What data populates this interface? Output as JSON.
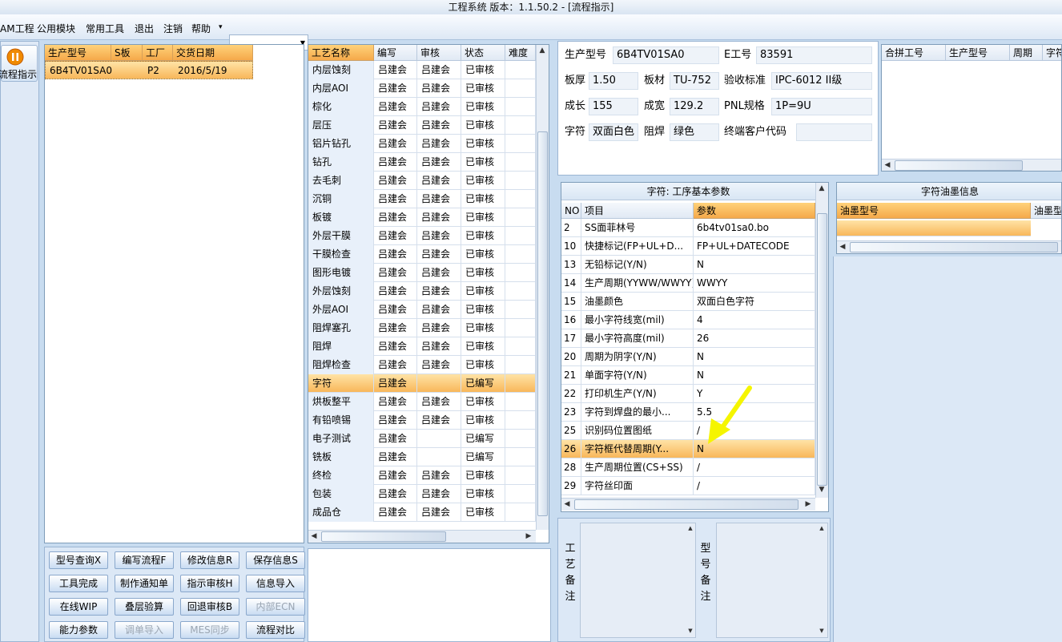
{
  "window": {
    "title": "工程系统  版本：1.1.50.2 - [流程指示]"
  },
  "menu": {
    "items": [
      "AM工程",
      "公用模块",
      "常用工具",
      "退出",
      "注销",
      "帮助"
    ],
    "help_arrow": "▾",
    "combo_value": ""
  },
  "sidebar": {
    "button_label": "流程指示",
    "icon": "pause-circle-icon"
  },
  "part_grid": {
    "headers": [
      "生产型号",
      "S板",
      "工厂",
      "交货日期"
    ],
    "rows": [
      [
        "6B4TV01SA0",
        "",
        "P2",
        "2016/5/19"
      ]
    ]
  },
  "process_grid": {
    "headers": [
      "工艺名称",
      "编写",
      "审核",
      "状态",
      "难度"
    ],
    "rows": [
      [
        "内层蚀刻",
        "吕建会",
        "吕建会",
        "已审核",
        ""
      ],
      [
        "内层AOI",
        "吕建会",
        "吕建会",
        "已审核",
        ""
      ],
      [
        "棕化",
        "吕建会",
        "吕建会",
        "已审核",
        ""
      ],
      [
        "层压",
        "吕建会",
        "吕建会",
        "已审核",
        ""
      ],
      [
        "铝片钻孔",
        "吕建会",
        "吕建会",
        "已审核",
        ""
      ],
      [
        "钻孔",
        "吕建会",
        "吕建会",
        "已审核",
        ""
      ],
      [
        "去毛刺",
        "吕建会",
        "吕建会",
        "已审核",
        ""
      ],
      [
        "沉铜",
        "吕建会",
        "吕建会",
        "已审核",
        ""
      ],
      [
        "板镀",
        "吕建会",
        "吕建会",
        "已审核",
        ""
      ],
      [
        "外层干膜",
        "吕建会",
        "吕建会",
        "已审核",
        ""
      ],
      [
        "干膜检查",
        "吕建会",
        "吕建会",
        "已审核",
        ""
      ],
      [
        "图形电镀",
        "吕建会",
        "吕建会",
        "已审核",
        ""
      ],
      [
        "外层蚀刻",
        "吕建会",
        "吕建会",
        "已审核",
        ""
      ],
      [
        "外层AOI",
        "吕建会",
        "吕建会",
        "已审核",
        ""
      ],
      [
        "阻焊塞孔",
        "吕建会",
        "吕建会",
        "已审核",
        ""
      ],
      [
        "阻焊",
        "吕建会",
        "吕建会",
        "已审核",
        ""
      ],
      [
        "阻焊检查",
        "吕建会",
        "吕建会",
        "已审核",
        ""
      ],
      [
        "字符",
        "吕建会",
        "",
        "已编写",
        ""
      ],
      [
        "烘板整平",
        "吕建会",
        "吕建会",
        "已审核",
        ""
      ],
      [
        "有铅喷锡",
        "吕建会",
        "吕建会",
        "已审核",
        ""
      ],
      [
        "电子测试",
        "吕建会",
        "",
        "已编写",
        ""
      ],
      [
        "铣板",
        "吕建会",
        "",
        "已编写",
        ""
      ],
      [
        "终检",
        "吕建会",
        "吕建会",
        "已审核",
        ""
      ],
      [
        "包装",
        "吕建会",
        "吕建会",
        "已审核",
        ""
      ],
      [
        "成品仓",
        "吕建会",
        "吕建会",
        "已审核",
        ""
      ]
    ],
    "selected_index": 17
  },
  "buttons": [
    [
      "型号查询X",
      "编写流程F",
      "修改信息R",
      "保存信息S"
    ],
    [
      "工具完成",
      "制作通知单",
      "指示审核H",
      "信息导入"
    ],
    [
      "在线WIP",
      "叠层验算",
      "回退审核B",
      "内部ECN"
    ],
    [
      "能力参数",
      "调单导入",
      "MES同步",
      "流程对比"
    ]
  ],
  "disabled_buttons": [
    "内部ECN",
    "调单导入",
    "MES同步"
  ],
  "info": {
    "labels": {
      "model": "生产型号",
      "eno": "E工号",
      "thickness": "板厚",
      "material": "板材",
      "standard": "验收标准",
      "length": "成长",
      "width": "成宽",
      "pnl": "PNL规格",
      "legend": "字符",
      "mask": "阻焊",
      "customer_code": "终端客户代码"
    },
    "values": {
      "model": "6B4TV01SA0",
      "eno": "83591",
      "thickness": "1.50",
      "material": "TU-752",
      "standard": "IPC-6012 II级",
      "length": "155",
      "width": "129.2",
      "pnl": "1P=9U",
      "legend": "双面白色",
      "mask": "绿色",
      "customer_code": ""
    }
  },
  "merge_grid": {
    "headers": [
      "合拼工号",
      "生产型号",
      "周期",
      "字符"
    ]
  },
  "params": {
    "caption": "字符: 工序基本参数",
    "headers": [
      "NO",
      "项目",
      "参数"
    ],
    "rows": [
      [
        "2",
        "SS面菲林号",
        "6b4tv01sa0.bo"
      ],
      [
        "10",
        "快捷标记(FP+UL+D...",
        "FP+UL+DATECODE"
      ],
      [
        "13",
        "无铅标记(Y/N)",
        "N"
      ],
      [
        "14",
        "生产周期(YYWW/WWYY)",
        "WWYY"
      ],
      [
        "15",
        "油墨颜色",
        "双面白色字符"
      ],
      [
        "16",
        "最小字符线宽(mil)",
        "4"
      ],
      [
        "17",
        "最小字符高度(mil)",
        "26"
      ],
      [
        "20",
        "周期为阴字(Y/N)",
        "N"
      ],
      [
        "21",
        "单面字符(Y/N)",
        "N"
      ],
      [
        "22",
        "打印机生产(Y/N)",
        "Y"
      ],
      [
        "23",
        "字符到焊盘的最小...",
        "5.5"
      ],
      [
        "25",
        "识别码位置图纸",
        "/"
      ],
      [
        "26",
        "字符框代替周期(Y...",
        "N"
      ],
      [
        "28",
        "生产周期位置(CS+SS)",
        "/"
      ],
      [
        "29",
        "字符丝印面",
        "/"
      ]
    ],
    "selected_index": 12
  },
  "ink": {
    "caption": "字符油墨信息",
    "headers": [
      "油墨型号",
      "油墨型"
    ]
  },
  "notes": {
    "process_label": [
      "工",
      "艺",
      "备",
      "注"
    ],
    "model_label": [
      "型",
      "号",
      "备",
      "注"
    ]
  },
  "colors": {
    "accent": "#f8b75a",
    "annotation_arrow": "#f5f500"
  }
}
